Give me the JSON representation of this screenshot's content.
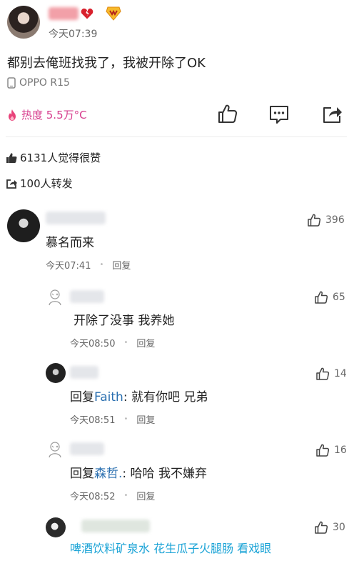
{
  "post": {
    "time": "今天07:39",
    "text": "都别去俺班找我了，我被开除了OK",
    "device": "OPPO R15",
    "heat": "热度 5.5万°C"
  },
  "stats": {
    "likes": "6131人觉得很赞",
    "reposts": "100人转发"
  },
  "comments": [
    {
      "text": "慕名而来",
      "time": "今天07:41",
      "reply": "回复",
      "likes": "396"
    },
    {
      "text": "开除了没事 我养她",
      "time": "今天08:50",
      "reply": "回复",
      "likes": "65"
    },
    {
      "prefix": "回复",
      "mention": "Faith",
      "rest": ": 就有你吧  兄弟",
      "time": "今天08:51",
      "reply": "回复",
      "likes": "14"
    },
    {
      "prefix": "回复",
      "mention": "森哲.",
      "rest": ":  哈哈 我不嫌弃",
      "time": "今天08:52",
      "reply": "回复",
      "likes": "16"
    },
    {
      "text": "啤酒饮料矿泉水 花生瓜子火腿肠 看戏眼",
      "likes": "30"
    }
  ],
  "colors": {
    "heat": "#d63b8c",
    "mention": "#2a6fb0",
    "caption": "#1aa3d6"
  }
}
